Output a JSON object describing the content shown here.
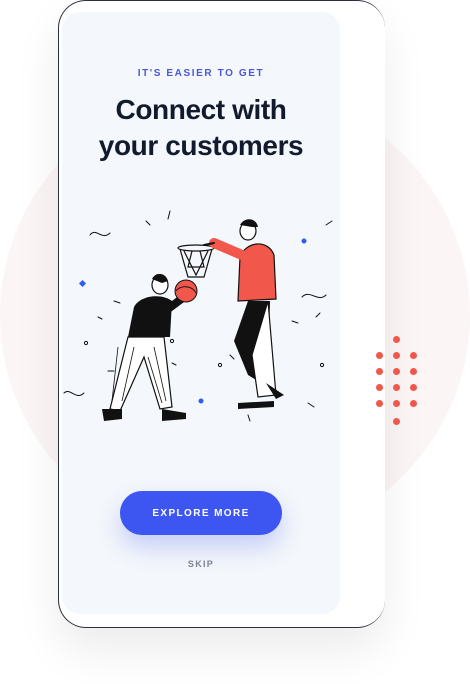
{
  "hero": {
    "eyebrow": "IT'S EASIER TO GET",
    "title_line1": "Connect with",
    "title_line2": "your customers"
  },
  "actions": {
    "explore_label": "EXPLORE MORE",
    "skip_label": "SKIP"
  },
  "colors": {
    "accent": "#3d55f1",
    "accent_text": "#4a57d8",
    "title": "#121a2d",
    "coral": "#f2574b",
    "screen_bg": "#f4f7fb"
  }
}
